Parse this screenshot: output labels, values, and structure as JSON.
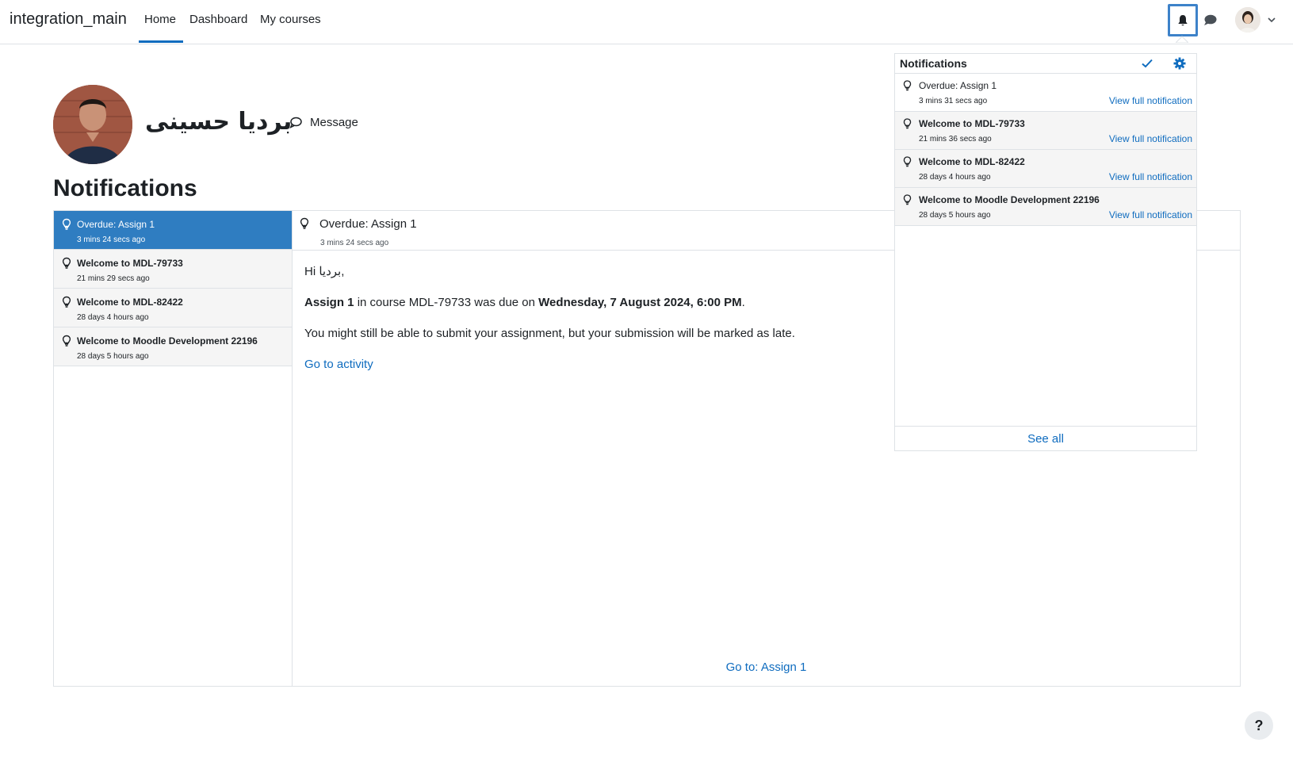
{
  "navbar": {
    "site_name": "integration_main",
    "links": [
      {
        "label": "Home",
        "active": true
      },
      {
        "label": "Dashboard"
      },
      {
        "label": "My courses"
      }
    ]
  },
  "profile": {
    "name": "بردیا حسینی",
    "message_label": "Message"
  },
  "page": {
    "title": "Notifications"
  },
  "notifications": [
    {
      "title": "Overdue: Assign 1",
      "time": "3 mins 24 secs ago"
    },
    {
      "title": "Welcome to MDL-79733",
      "time": "21 mins 29 secs ago"
    },
    {
      "title": "Welcome to MDL-82422",
      "time": "28 days 4 hours ago"
    },
    {
      "title": "Welcome to Moodle Development 22196",
      "time": "28 days 5 hours ago"
    }
  ],
  "detail": {
    "title": "Overdue: Assign 1",
    "time": "3 mins 24 secs ago",
    "greeting": "Hi بردیا,",
    "line2_part1": "Assign 1",
    "line2_part2": " in course MDL-79733 was due on ",
    "line2_part3": "Wednesday, 7 August 2024, 6:00 PM",
    "line2_part4": ".",
    "line3": "You might still be able to submit your assignment, but your submission will be marked as late.",
    "activity_link": "Go to activity",
    "goto_link": "Go to: Assign 1"
  },
  "popover": {
    "title": "Notifications",
    "items": [
      {
        "title": "Overdue: Assign 1",
        "time": "3 mins 31 secs ago",
        "link": "View full notification"
      },
      {
        "title": "Welcome to MDL-79733",
        "time": "21 mins 36 secs ago",
        "link": "View full notification"
      },
      {
        "title": "Welcome to MDL-82422",
        "time": "28 days 4 hours ago",
        "link": "View full notification"
      },
      {
        "title": "Welcome to Moodle Development 22196",
        "time": "28 days 5 hours ago",
        "link": "View full notification"
      }
    ],
    "see_all": "See all"
  },
  "help": {
    "label": "?"
  },
  "colors": {
    "accent": "#0f6cbf",
    "active_item": "#2f7dc1",
    "item_bg": "#f5f5f5",
    "border": "#dee2e6"
  }
}
